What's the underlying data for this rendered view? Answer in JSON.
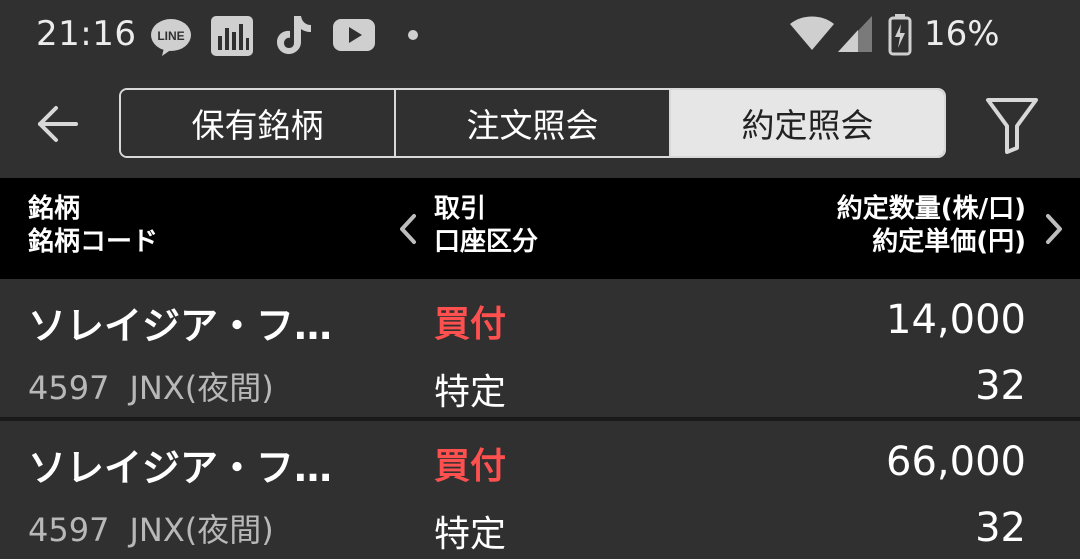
{
  "status_bar": {
    "time": "21:16",
    "icons": [
      "line-icon",
      "equalizer-icon",
      "tiktok-icon",
      "youtube-icon",
      "notification-dot-icon"
    ],
    "battery_percent": "16%"
  },
  "header": {
    "tabs": [
      {
        "label": "保有銘柄",
        "active": false
      },
      {
        "label": "注文照会",
        "active": false
      },
      {
        "label": "約定照会",
        "active": true
      }
    ]
  },
  "columns": {
    "left_line1": "銘柄",
    "left_line2": "銘柄コード",
    "mid_line1": "取引",
    "mid_line2": "口座区分",
    "right_line1": "約定数量(株/口)",
    "right_line2": "約定単価(円)"
  },
  "rows": [
    {
      "name": "ソレイジア・フ…",
      "code": "4597",
      "market": "JNX(夜間)",
      "side": "買付",
      "account": "特定",
      "quantity": "14,000",
      "price": "32"
    },
    {
      "name": "ソレイジア・フ…",
      "code": "4597",
      "market": "JNX(夜間)",
      "side": "買付",
      "account": "特定",
      "quantity": "66,000",
      "price": "32"
    }
  ],
  "colors": {
    "background": "#303030",
    "header_bar": "#000000",
    "buy_red": "#ff5050",
    "active_tab": "#e6e6e6"
  }
}
